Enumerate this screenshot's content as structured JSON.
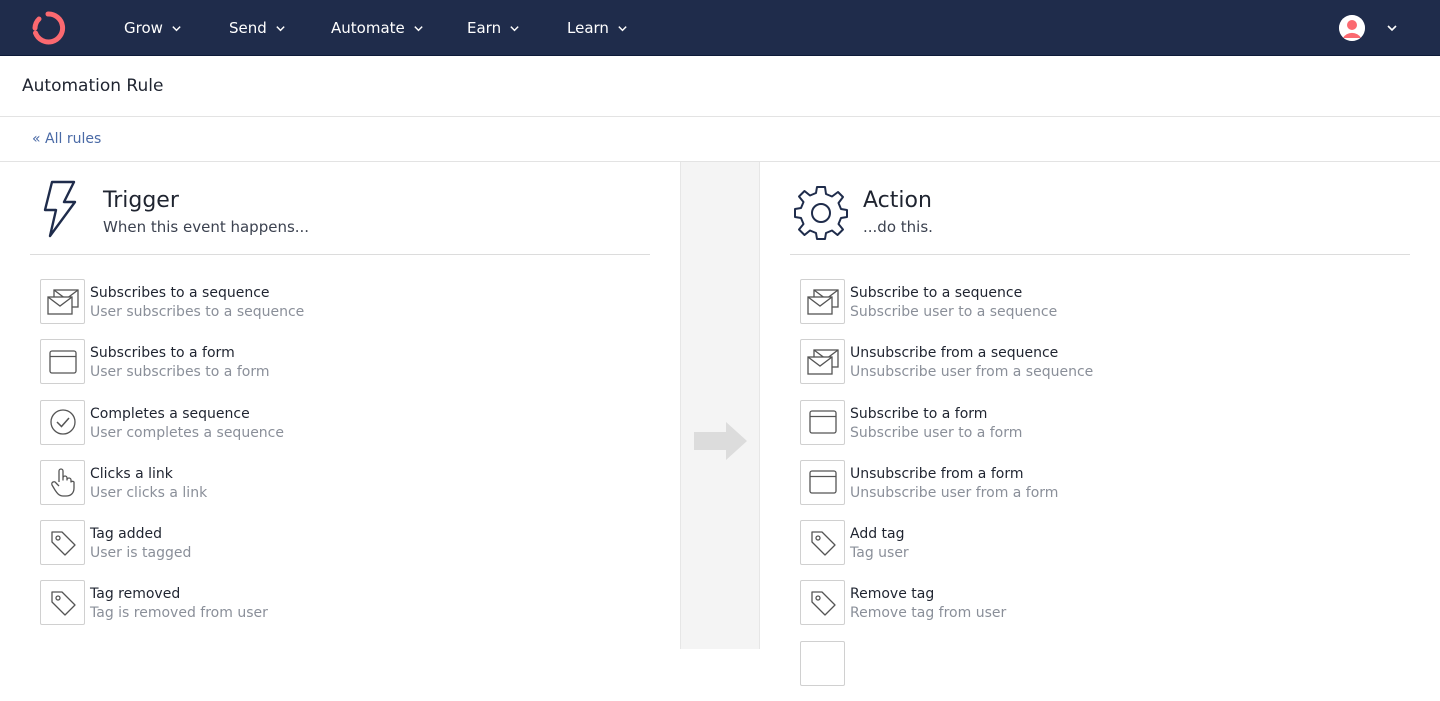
{
  "nav": {
    "items": [
      {
        "label": "Grow"
      },
      {
        "label": "Send"
      },
      {
        "label": "Automate"
      },
      {
        "label": "Earn"
      },
      {
        "label": "Learn"
      }
    ],
    "brand_color": "#fb6970",
    "bar_color": "#1f2c4b"
  },
  "page": {
    "title": "Automation Rule",
    "back_link": "« All rules"
  },
  "trigger": {
    "title": "Trigger",
    "subtitle": "When this event happens...",
    "items": [
      {
        "icon": "sequence-icon",
        "title": "Subscribes to a sequence",
        "subtitle": "User subscribes to a sequence"
      },
      {
        "icon": "form-icon",
        "title": "Subscribes to a form",
        "subtitle": "User subscribes to a form"
      },
      {
        "icon": "check-circle-icon",
        "title": "Completes a sequence",
        "subtitle": "User completes a sequence"
      },
      {
        "icon": "pointer-hand-icon",
        "title": "Clicks a link",
        "subtitle": "User clicks a link"
      },
      {
        "icon": "tag-icon",
        "title": "Tag added",
        "subtitle": "User is tagged"
      },
      {
        "icon": "tag-icon",
        "title": "Tag removed",
        "subtitle": "Tag is removed from user"
      }
    ]
  },
  "action": {
    "title": "Action",
    "subtitle": "...do this.",
    "items": [
      {
        "icon": "sequence-icon",
        "title": "Subscribe to a sequence",
        "subtitle": "Subscribe user to a sequence"
      },
      {
        "icon": "sequence-icon",
        "title": "Unsubscribe from a sequence",
        "subtitle": "Unsubscribe user from a sequence"
      },
      {
        "icon": "form-icon",
        "title": "Subscribe to a form",
        "subtitle": "Subscribe user to a form"
      },
      {
        "icon": "form-icon",
        "title": "Unsubscribe from a form",
        "subtitle": "Unsubscribe user from a form"
      },
      {
        "icon": "tag-icon",
        "title": "Add tag",
        "subtitle": "Tag user"
      },
      {
        "icon": "tag-icon",
        "title": "Remove tag",
        "subtitle": "Remove tag from user"
      }
    ]
  }
}
